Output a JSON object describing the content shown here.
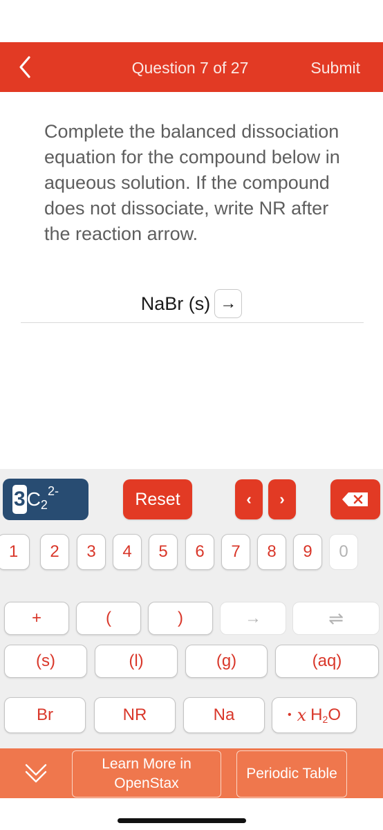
{
  "header": {
    "back_icon": "chevron-left-icon",
    "title": "Question 7 of 27",
    "submit_label": "Submit",
    "color": "#e23a24"
  },
  "question": {
    "text": "Complete the balanced dissociation equation for the compound below in aqueous solution. If the compound does not dissociate, write NR after the reaction arrow.",
    "equation_left": "NaBr (s)",
    "arrow": "→",
    "answer_value": ""
  },
  "keyboard": {
    "charge_button": {
      "digit": "3",
      "element": "C",
      "subscript": "2",
      "superscript": "2-"
    },
    "reset_label": "Reset",
    "prev_label": "‹",
    "next_label": "›",
    "delete_icon": "backspace-icon",
    "digits": [
      {
        "label": "1",
        "enabled": true
      },
      {
        "label": "2",
        "enabled": true
      },
      {
        "label": "3",
        "enabled": true
      },
      {
        "label": "4",
        "enabled": true
      },
      {
        "label": "5",
        "enabled": true
      },
      {
        "label": "6",
        "enabled": true
      },
      {
        "label": "7",
        "enabled": true
      },
      {
        "label": "8",
        "enabled": true
      },
      {
        "label": "9",
        "enabled": true
      },
      {
        "label": "0",
        "enabled": false
      }
    ],
    "symbols": [
      {
        "label": "+",
        "enabled": true
      },
      {
        "label": "(",
        "enabled": true
      },
      {
        "label": ")",
        "enabled": true
      },
      {
        "label": "→",
        "enabled": false
      },
      {
        "label": "⇌",
        "enabled": false
      }
    ],
    "states": [
      {
        "label": "(s)"
      },
      {
        "label": "(l)"
      },
      {
        "label": "(g)"
      },
      {
        "label": "(aq)"
      }
    ],
    "elements": [
      {
        "label": "Br"
      },
      {
        "label": "NR"
      },
      {
        "label": "Na"
      }
    ],
    "hydrate": {
      "dot": "•",
      "x": "x",
      "formula_h": "H",
      "formula_sub": "2",
      "formula_o": "O"
    }
  },
  "bottom_bar": {
    "collapse_icon": "double-chevron-down-icon",
    "learn_more_line1": "Learn More in",
    "learn_more_line2": "OpenStax",
    "periodic_table_label": "Periodic Table",
    "color": "#ef774d"
  }
}
